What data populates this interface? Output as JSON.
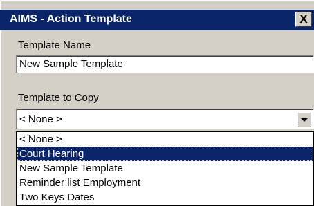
{
  "window": {
    "title": "AIMS - Action Template",
    "close_label": "X"
  },
  "template_name": {
    "label": "Template Name",
    "value": "New Sample Template"
  },
  "template_copy": {
    "label": "Template to Copy",
    "selected_value": "< None >",
    "options": [
      "< None >",
      "Court Hearing",
      "New Sample Template",
      "Reminder list Employment",
      "Two Keys Dates"
    ],
    "highlighted_index": 1
  }
}
